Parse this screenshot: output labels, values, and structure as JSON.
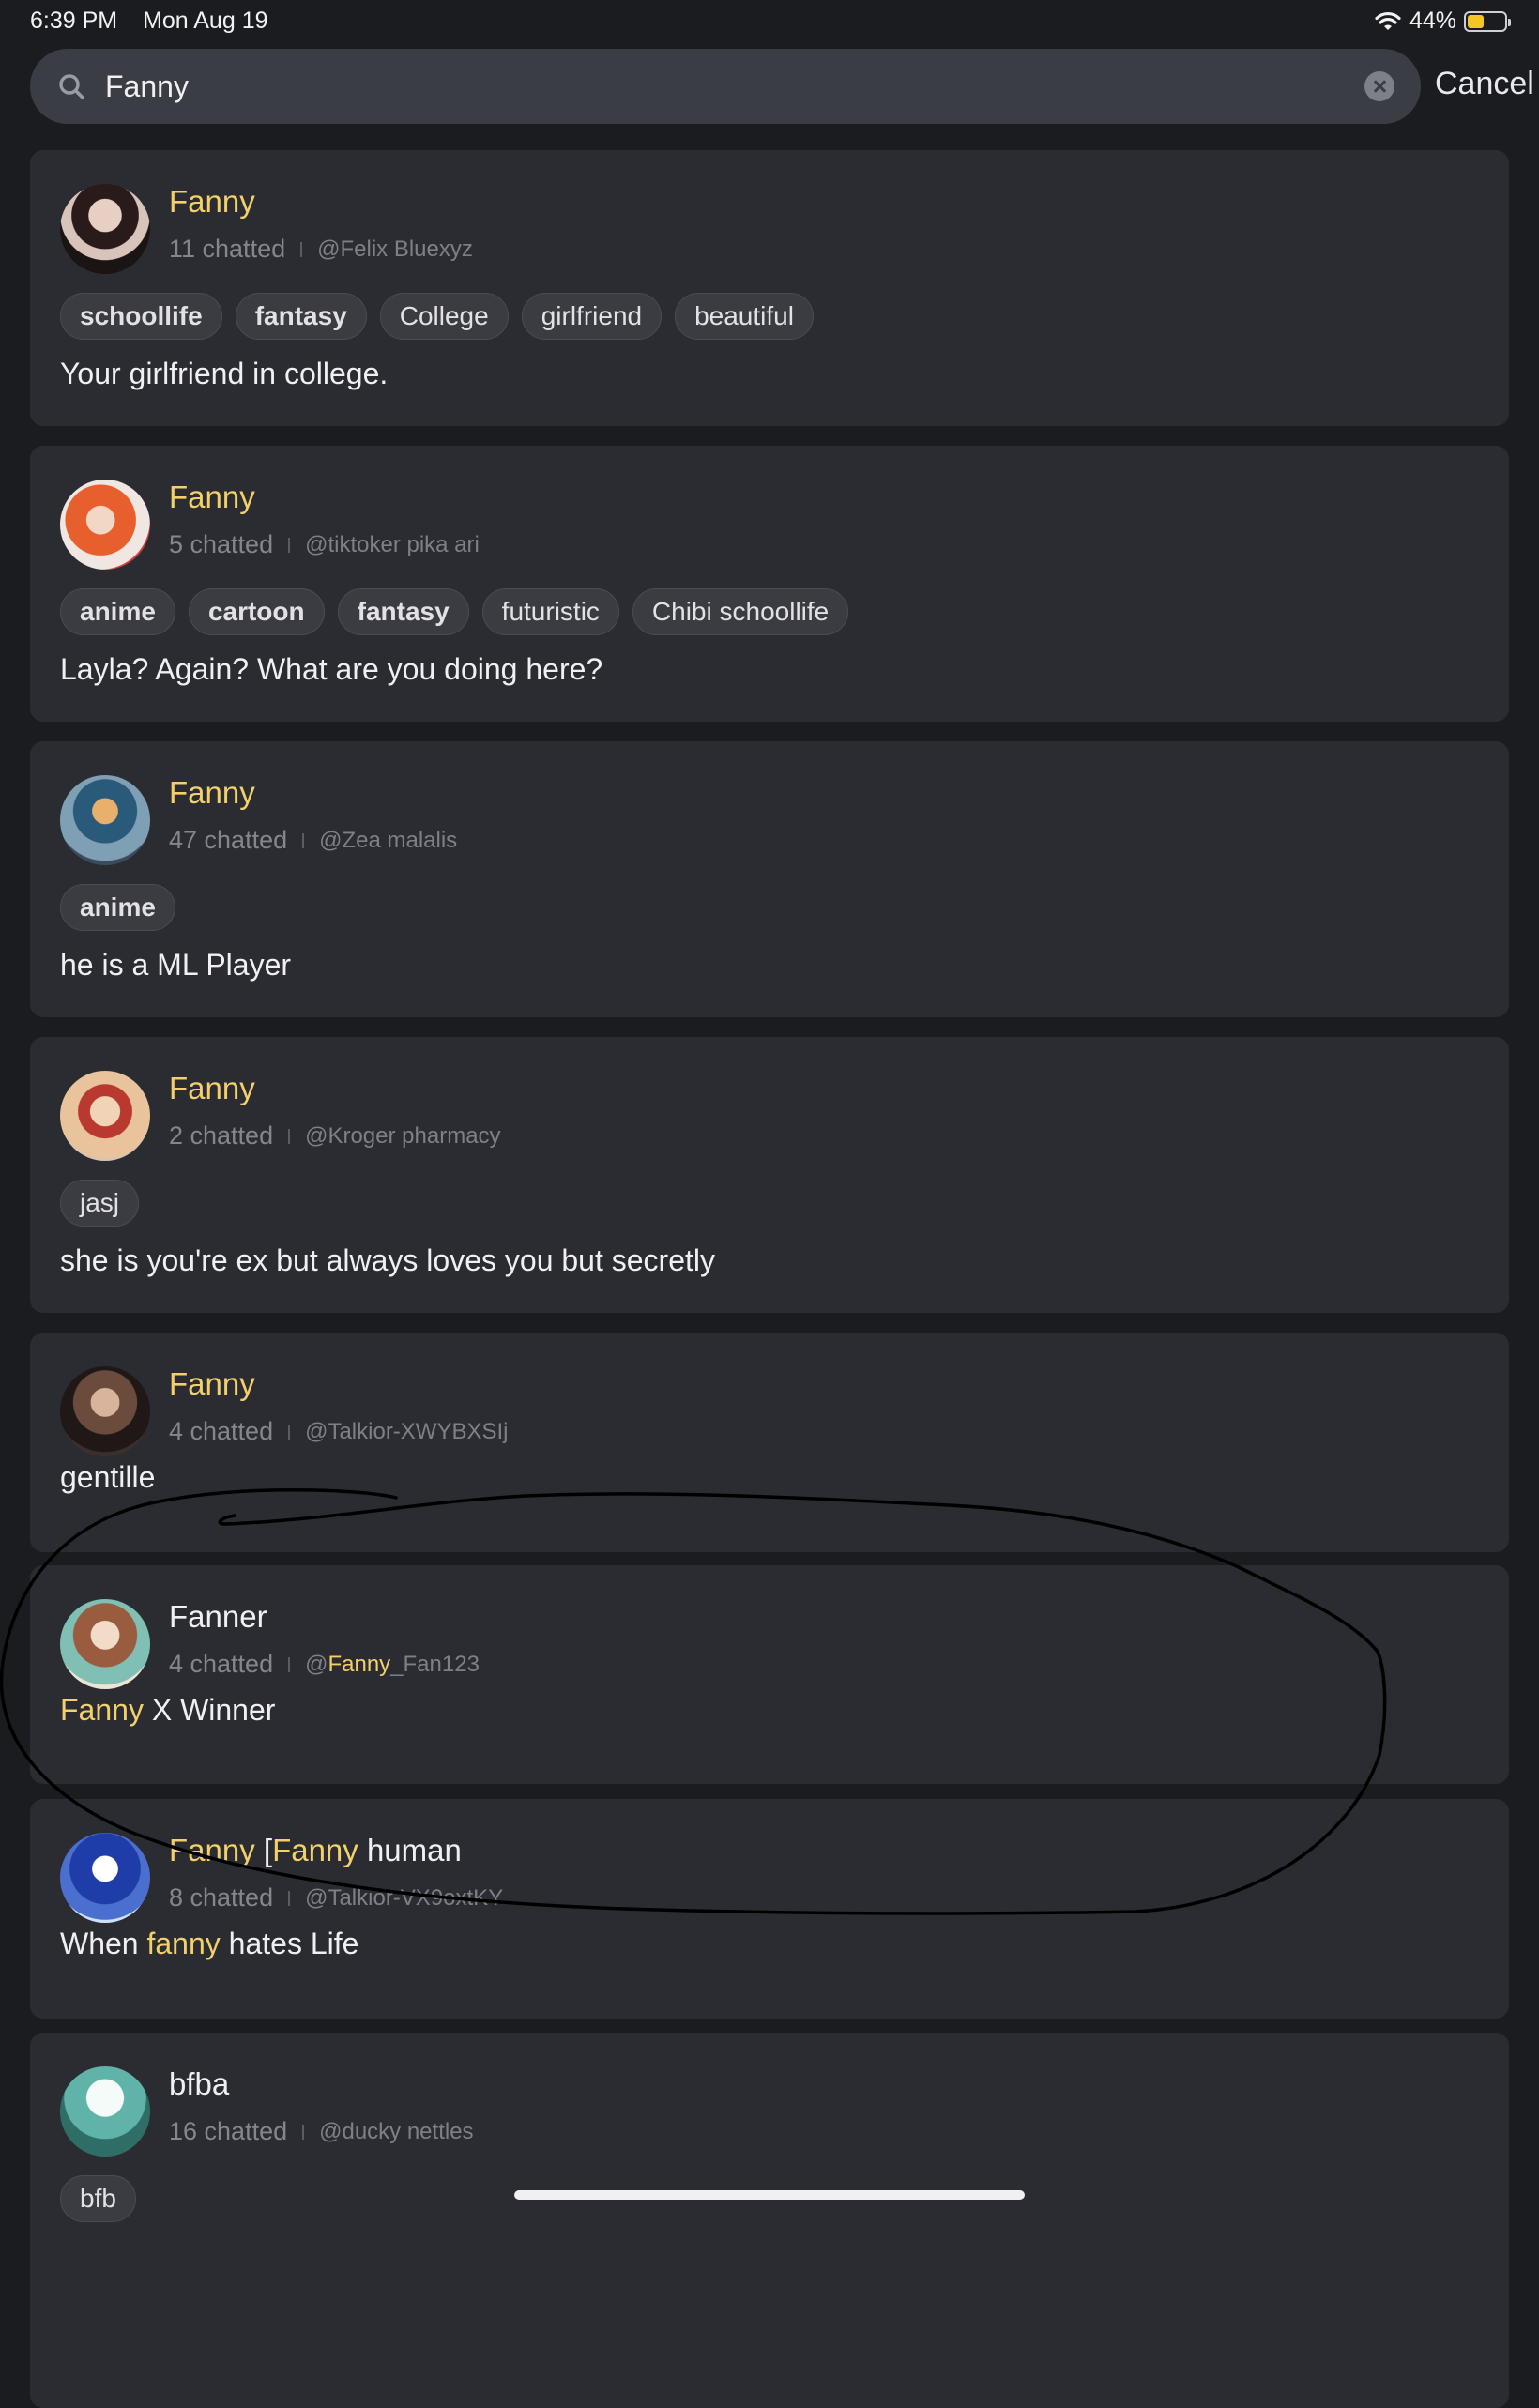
{
  "status_bar": {
    "time": "6:39 PM",
    "date": "Mon Aug 19",
    "battery": "44%",
    "battery_level": 0.44
  },
  "search": {
    "query": "Fanny",
    "placeholder": "",
    "cancel_label": "Cancel"
  },
  "colors": {
    "background": "#1b1c20",
    "card": "#2a2c31",
    "highlight": "#f3d06b",
    "muted": "#84868e"
  },
  "results": [
    {
      "name": [
        {
          "t": "Fanny",
          "hl": true
        }
      ],
      "chatted": "11 chatted",
      "creator": [
        {
          "t": "@Felix Bluexyz",
          "hl": false
        }
      ],
      "tags": [
        {
          "t": "schoollife",
          "b": true
        },
        {
          "t": "fantasy",
          "b": true
        },
        {
          "t": "College",
          "b": false
        },
        {
          "t": "girlfriend",
          "b": false
        },
        {
          "t": "beautiful",
          "b": false
        }
      ],
      "description": [
        {
          "t": "Your girlfriend in college.",
          "hl": false
        }
      ]
    },
    {
      "name": [
        {
          "t": "Fanny",
          "hl": true
        }
      ],
      "chatted": "5 chatted",
      "creator": [
        {
          "t": "@tiktoker pika ari",
          "hl": false
        }
      ],
      "tags": [
        {
          "t": "anime",
          "b": true
        },
        {
          "t": "cartoon",
          "b": true
        },
        {
          "t": "fantasy",
          "b": true
        },
        {
          "t": "futuristic",
          "b": false
        },
        {
          "t": "Chibi schoollife",
          "b": false
        }
      ],
      "description": [
        {
          "t": "Layla? Again? What are you doing here?",
          "hl": false
        }
      ]
    },
    {
      "name": [
        {
          "t": "Fanny",
          "hl": true
        }
      ],
      "chatted": "47 chatted",
      "creator": [
        {
          "t": "@Zea malalis",
          "hl": false
        }
      ],
      "tags": [
        {
          "t": "anime",
          "b": true
        }
      ],
      "description": [
        {
          "t": "he is a ML Player",
          "hl": false
        }
      ]
    },
    {
      "name": [
        {
          "t": "Fanny",
          "hl": true
        }
      ],
      "chatted": "2 chatted",
      "creator": [
        {
          "t": "@Kroger pharmacy",
          "hl": false
        }
      ],
      "tags": [
        {
          "t": "jasj",
          "b": false
        }
      ],
      "description": [
        {
          "t": "she is you're ex but always loves you but secretly",
          "hl": false
        }
      ]
    },
    {
      "name": [
        {
          "t": "Fanny",
          "hl": true
        }
      ],
      "chatted": "4 chatted",
      "creator": [
        {
          "t": "@Talkior-XWYBXSIj",
          "hl": false
        }
      ],
      "tags": [],
      "description": [
        {
          "t": "gentille",
          "hl": false
        }
      ]
    },
    {
      "name": [
        {
          "t": "Fanner",
          "hl": false
        }
      ],
      "chatted": "4 chatted",
      "creator": [
        {
          "t": "@",
          "hl": false
        },
        {
          "t": "Fanny",
          "hl": true
        },
        {
          "t": "_Fan123",
          "hl": false
        }
      ],
      "tags": [],
      "description": [
        {
          "t": "Fanny",
          "hl": true
        },
        {
          "t": " X Winner",
          "hl": false
        }
      ]
    },
    {
      "name": [
        {
          "t": "Fanny",
          "hl": true
        },
        {
          "t": " [",
          "hl": false
        },
        {
          "t": "Fanny",
          "hl": true
        },
        {
          "t": " human",
          "hl": false
        }
      ],
      "chatted": "8 chatted",
      "creator": [
        {
          "t": "@Talkior-VX9oxtKY",
          "hl": false
        }
      ],
      "tags": [],
      "description": [
        {
          "t": "When ",
          "hl": false
        },
        {
          "t": "fanny",
          "hl": true
        },
        {
          "t": " hates Life",
          "hl": false
        }
      ]
    },
    {
      "name": [
        {
          "t": "bfba",
          "hl": false
        }
      ],
      "chatted": "16 chatted",
      "creator": [
        {
          "t": "@ducky nettles",
          "hl": false
        }
      ],
      "tags": [
        {
          "t": "bfb",
          "b": false
        }
      ],
      "description": []
    }
  ]
}
